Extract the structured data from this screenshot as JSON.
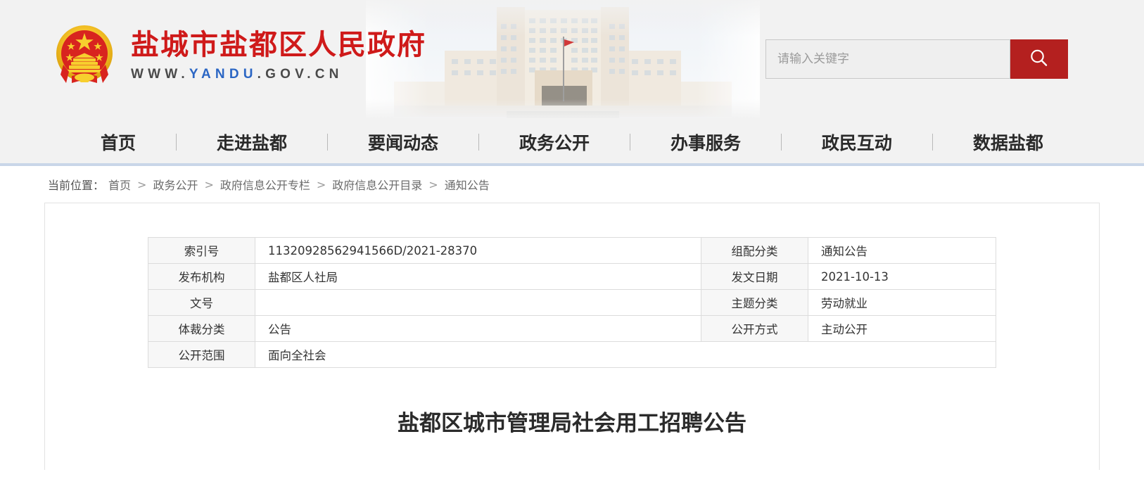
{
  "site": {
    "emblem_icon": "china-national-emblem-icon",
    "title_cn": "盐城市盐都区人民政府",
    "url_parts": {
      "p1": "WWW.",
      "p2": "YANDU",
      "p3": ".GOV.CN"
    },
    "url_full": "WWW.YANDU.GOV.CN",
    "banner_image_alt": "government-building",
    "accent_red": "#b4201f",
    "title_red": "#cf1a1a",
    "url_blue": "#2b66c4"
  },
  "search": {
    "placeholder": "请输入关键字",
    "value": "",
    "button_icon": "search-icon"
  },
  "nav": {
    "items": [
      {
        "label": "首页"
      },
      {
        "label": "走进盐都"
      },
      {
        "label": "要闻动态"
      },
      {
        "label": "政务公开"
      },
      {
        "label": "办事服务"
      },
      {
        "label": "政民互动"
      },
      {
        "label": "数据盐都"
      }
    ]
  },
  "breadcrumb": {
    "label": "当前位置：",
    "separator": ">",
    "items": [
      {
        "label": "首页"
      },
      {
        "label": "政务公开"
      },
      {
        "label": "政府信息公开专栏"
      },
      {
        "label": "政府信息公开目录"
      },
      {
        "label": "通知公告"
      }
    ]
  },
  "meta": {
    "rows": [
      {
        "k1": "索引号",
        "v1": "11320928562941566D/2021-28370",
        "k2": "组配分类",
        "v2": "通知公告"
      },
      {
        "k1": "发布机构",
        "v1": "盐都区人社局",
        "k2": "发文日期",
        "v2": "2021-10-13"
      },
      {
        "k1": "文号",
        "v1": "",
        "k2": "主题分类",
        "v2": "劳动就业"
      },
      {
        "k1": "体裁分类",
        "v1": "公告",
        "k2": "公开方式",
        "v2": "主动公开"
      }
    ],
    "full_row": {
      "k": "公开范围",
      "v": "面向全社会"
    }
  },
  "article": {
    "title": "盐都区城市管理局社会用工招聘公告"
  }
}
